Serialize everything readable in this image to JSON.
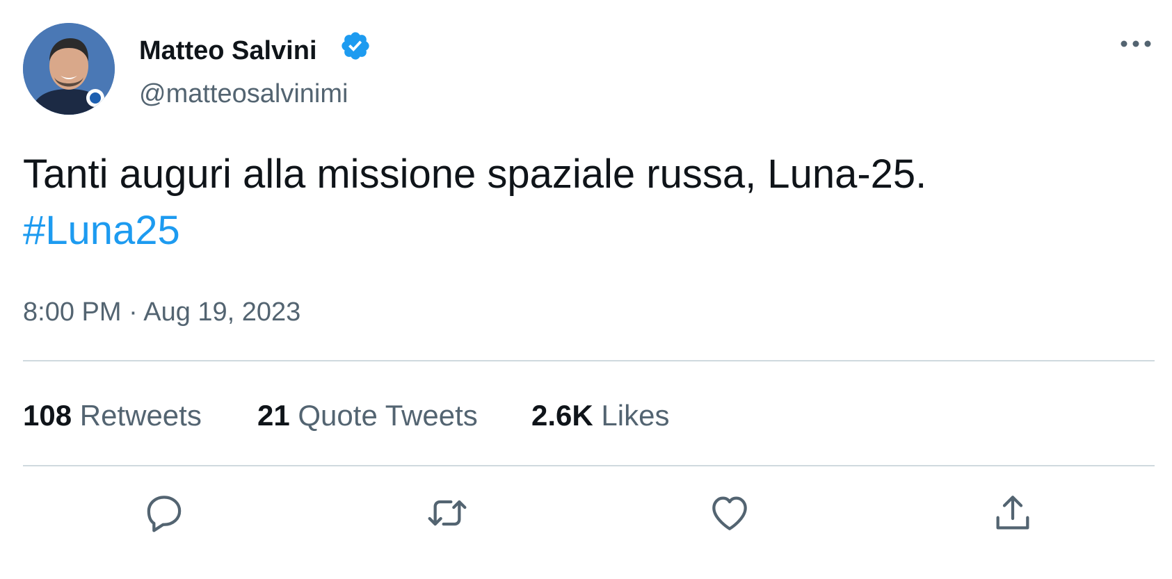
{
  "author": {
    "name": "Matteo Salvini",
    "handle": "@matteosalvinimi",
    "verified": true,
    "verified_color": "#1d9bf0"
  },
  "tweet": {
    "text": "Tanti auguri alla missione spaziale russa, Luna-25.",
    "hashtag": "#Luna25",
    "time": "8:00 PM",
    "separator": "·",
    "date": "Aug 19, 2023"
  },
  "stats": {
    "retweets_count": "108",
    "retweets_label": "Retweets",
    "quotes_count": "21",
    "quotes_label": "Quote Tweets",
    "likes_count": "2.6K",
    "likes_label": "Likes"
  },
  "actions": {
    "reply_icon": "reply-icon",
    "retweet_icon": "retweet-icon",
    "like_icon": "heart-icon",
    "share_icon": "share-icon",
    "more_icon": "more-icon"
  },
  "colors": {
    "text": "#0f1419",
    "secondary": "#536471",
    "link": "#1d9bf0",
    "divider": "#cfd9de"
  }
}
